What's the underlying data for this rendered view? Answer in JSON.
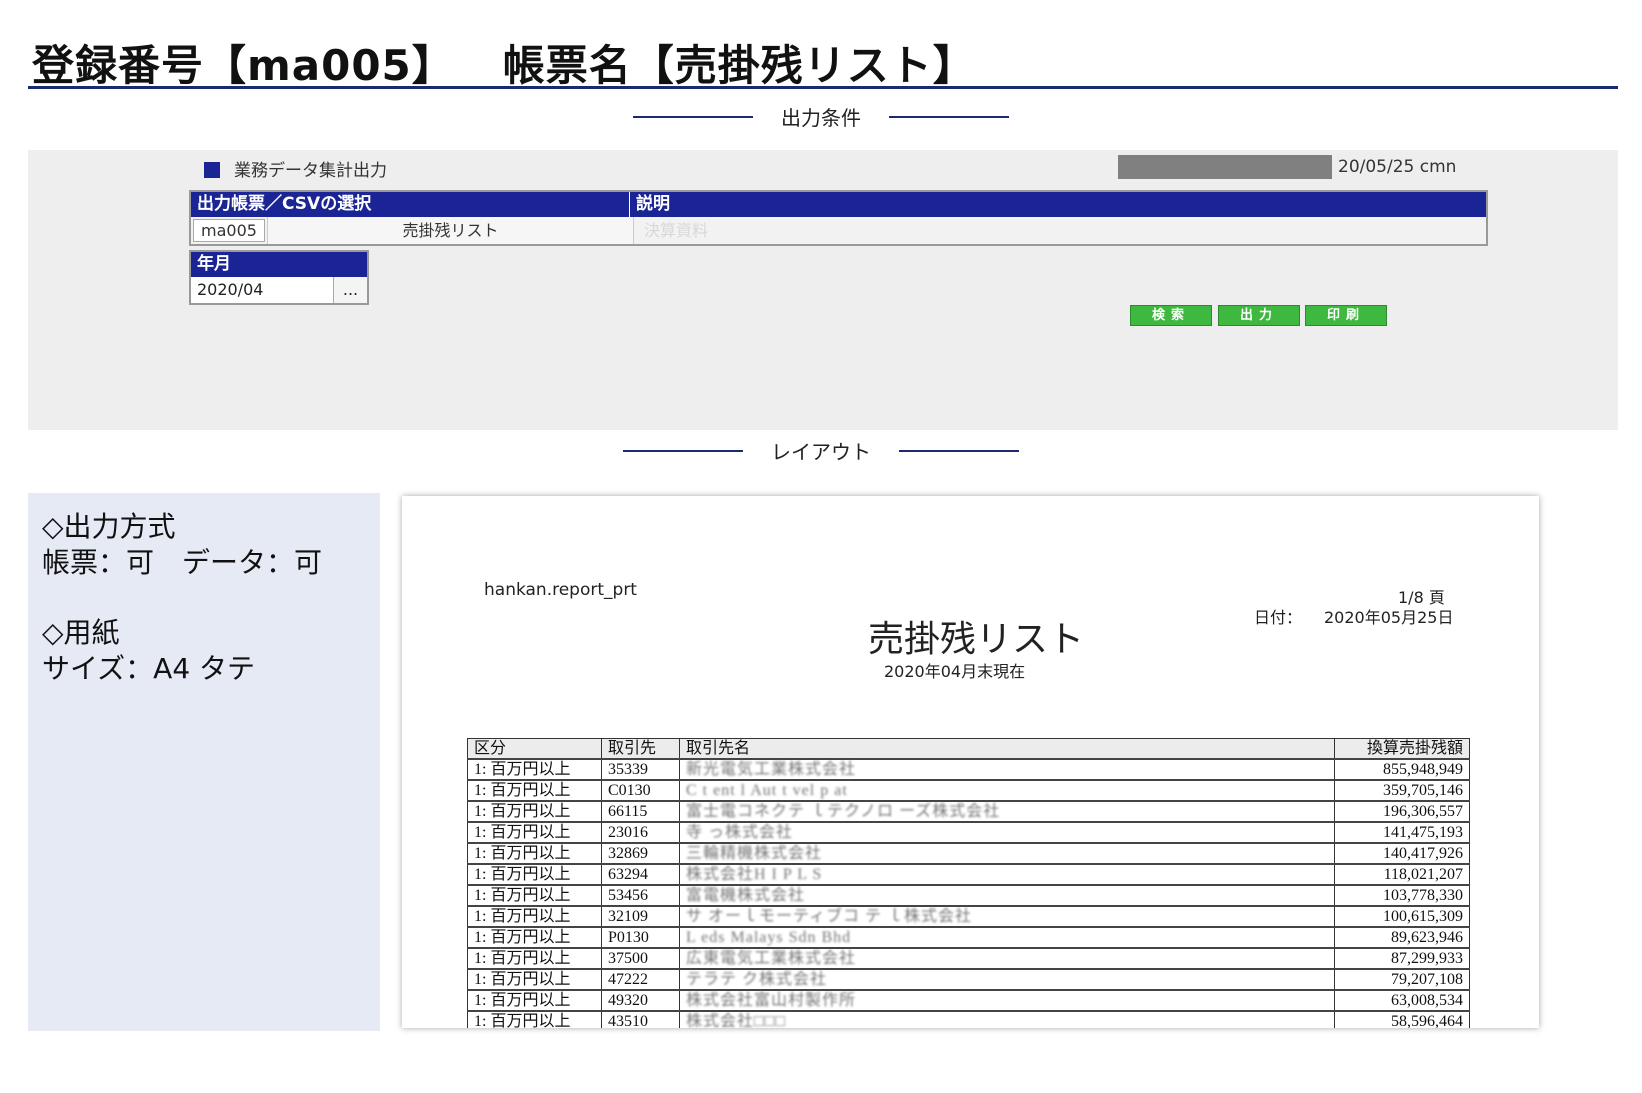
{
  "header": {
    "registration": "登録番号【ma005】",
    "report_name": "帳票名【売掛残リスト】"
  },
  "conditions_caption": "出力条件",
  "layout_caption": "レイアウト",
  "screen": {
    "title": "業務データ集計出力",
    "user_info": "20/05/25 cmn",
    "table_headers": {
      "selection": "出力帳票／CSVの選択",
      "description": "説明"
    },
    "selected_code": "ma005",
    "selected_name": "売掛残リスト",
    "selected_description": "決算資料",
    "period_label": "年月",
    "period_value": "2020/04",
    "period_picker": "...",
    "buttons": {
      "search": "検索",
      "output": "出力",
      "print": "印刷"
    }
  },
  "info": {
    "method_title": "◇出力方式",
    "method_value": "帳票：可　データ：可",
    "paper_title": "◇用紙",
    "paper_value": "サイズ：A4 タテ"
  },
  "preview": {
    "program": "hankan.report_prt",
    "page": "1/8 頁",
    "date_label": "日付：",
    "date_value": "2020年05月25日",
    "title": "売掛残リスト",
    "subtitle": "2020年04月末現在",
    "columns": [
      "区分",
      "取引先",
      "取引先名",
      "換算売掛残額"
    ],
    "rows": [
      [
        "1: 百万円以上",
        "35339",
        "新光電気工業株式会社",
        "855,948,949"
      ],
      [
        "1: 百万円以上",
        "C0130",
        "C t ent l Aut t vel p at",
        "359,705,146"
      ],
      [
        "1: 百万円以上",
        "66115",
        "富士電コネクテ ｌテクノロ ーズ株式会社",
        "196,306,557"
      ],
      [
        "1: 百万円以上",
        "23016",
        "寺 っ株式会社",
        "141,475,193"
      ],
      [
        "1: 百万円以上",
        "32869",
        "三輪精機株式会社",
        "140,417,926"
      ],
      [
        "1: 百万円以上",
        "63294",
        "株式会社H I P L S",
        "118,021,207"
      ],
      [
        "1: 百万円以上",
        "53456",
        "富電機株式会社",
        "103,778,330"
      ],
      [
        "1: 百万円以上",
        "32109",
        "サ オーｌモーティブコ テ ｌ株式会社",
        "100,615,309"
      ],
      [
        "1: 百万円以上",
        "P0130",
        "L eds Malays Sdn Bhd",
        "89,623,946"
      ],
      [
        "1: 百万円以上",
        "37500",
        "広東電気工業株式会社",
        "87,299,933"
      ],
      [
        "1: 百万円以上",
        "47222",
        "テラテ ク株式会社",
        "79,207,108"
      ],
      [
        "1: 百万円以上",
        "49320",
        "株式会社富山村製作所",
        "63,008,534"
      ],
      [
        "1: 百万円以上",
        "43510",
        "株式会社□□□",
        "58,596,464"
      ]
    ]
  }
}
